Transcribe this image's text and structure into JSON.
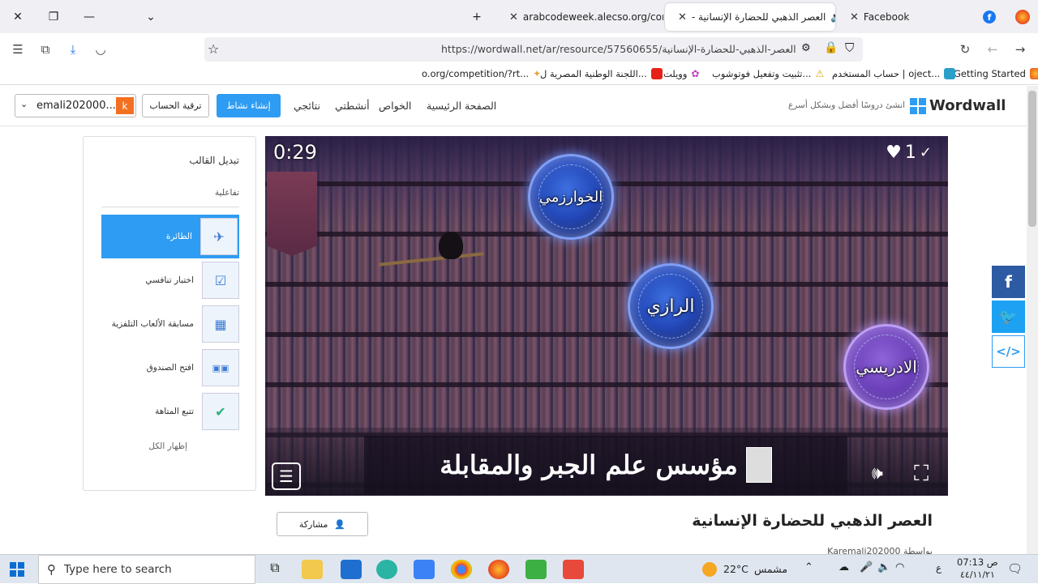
{
  "tabs": [
    {
      "label": "Facebook",
      "active": false
    },
    {
      "label": "العصر الذهبي للحضارة الإنسانية -",
      "active": true
    },
    {
      "label": "arabcodeweek.alecso.org/com",
      "active": false
    }
  ],
  "new_tab": "+",
  "url": "https://wordwall.net/ar/resource/57560655/العصر-الذهبي-للحضارة-الإنسانية",
  "bookmarks": [
    "Getting Started",
    "حساب المستخدم | oject...",
    "تثبيت وتفعيل فوتوشوب...",
    "وويلت",
    "اللجنة الوطنية المصرية ل...",
    "o.org/competition/?rt..."
  ],
  "site": {
    "logo_text": "Wordwall",
    "tagline": "انشئ دروسًا أفضل وبشكل أسرع",
    "nav": [
      "الصفحة الرئيسية",
      "الخواص",
      "أنشطتي",
      "نتائجي"
    ],
    "create_btn": "إنشاء نشاط",
    "upgrade_btn": "ترقية الحساب",
    "user_initial": "k",
    "user_name": "emali202000..."
  },
  "left_panel": {
    "title": "تبديل القالب",
    "section": "تفاعلية",
    "templates": [
      "الطائرة",
      "اختبار تنافسي",
      "مسابقة الألعاب التلفزية",
      "افتح الصندوق",
      "تتبع المتاهة"
    ],
    "show_all": "إظهار الكل"
  },
  "game": {
    "timer": "0:29",
    "lives": "1",
    "answers": [
      "الخوارزمي",
      "الرازي",
      "الادريسي"
    ],
    "question": "مؤسس علم الجبر والمقابلة"
  },
  "activity": {
    "title": "العصر الذهبي للحضارة الإنسانية",
    "share": "مشاركة",
    "author": "Karemali202000 بواسطة"
  },
  "taskbar": {
    "search_placeholder": "Type here to search",
    "weather": "22°C",
    "weather_label": "مشمس",
    "time": "07:13 ص",
    "date": "٤٤/١١/٢١",
    "lang": "ع"
  }
}
